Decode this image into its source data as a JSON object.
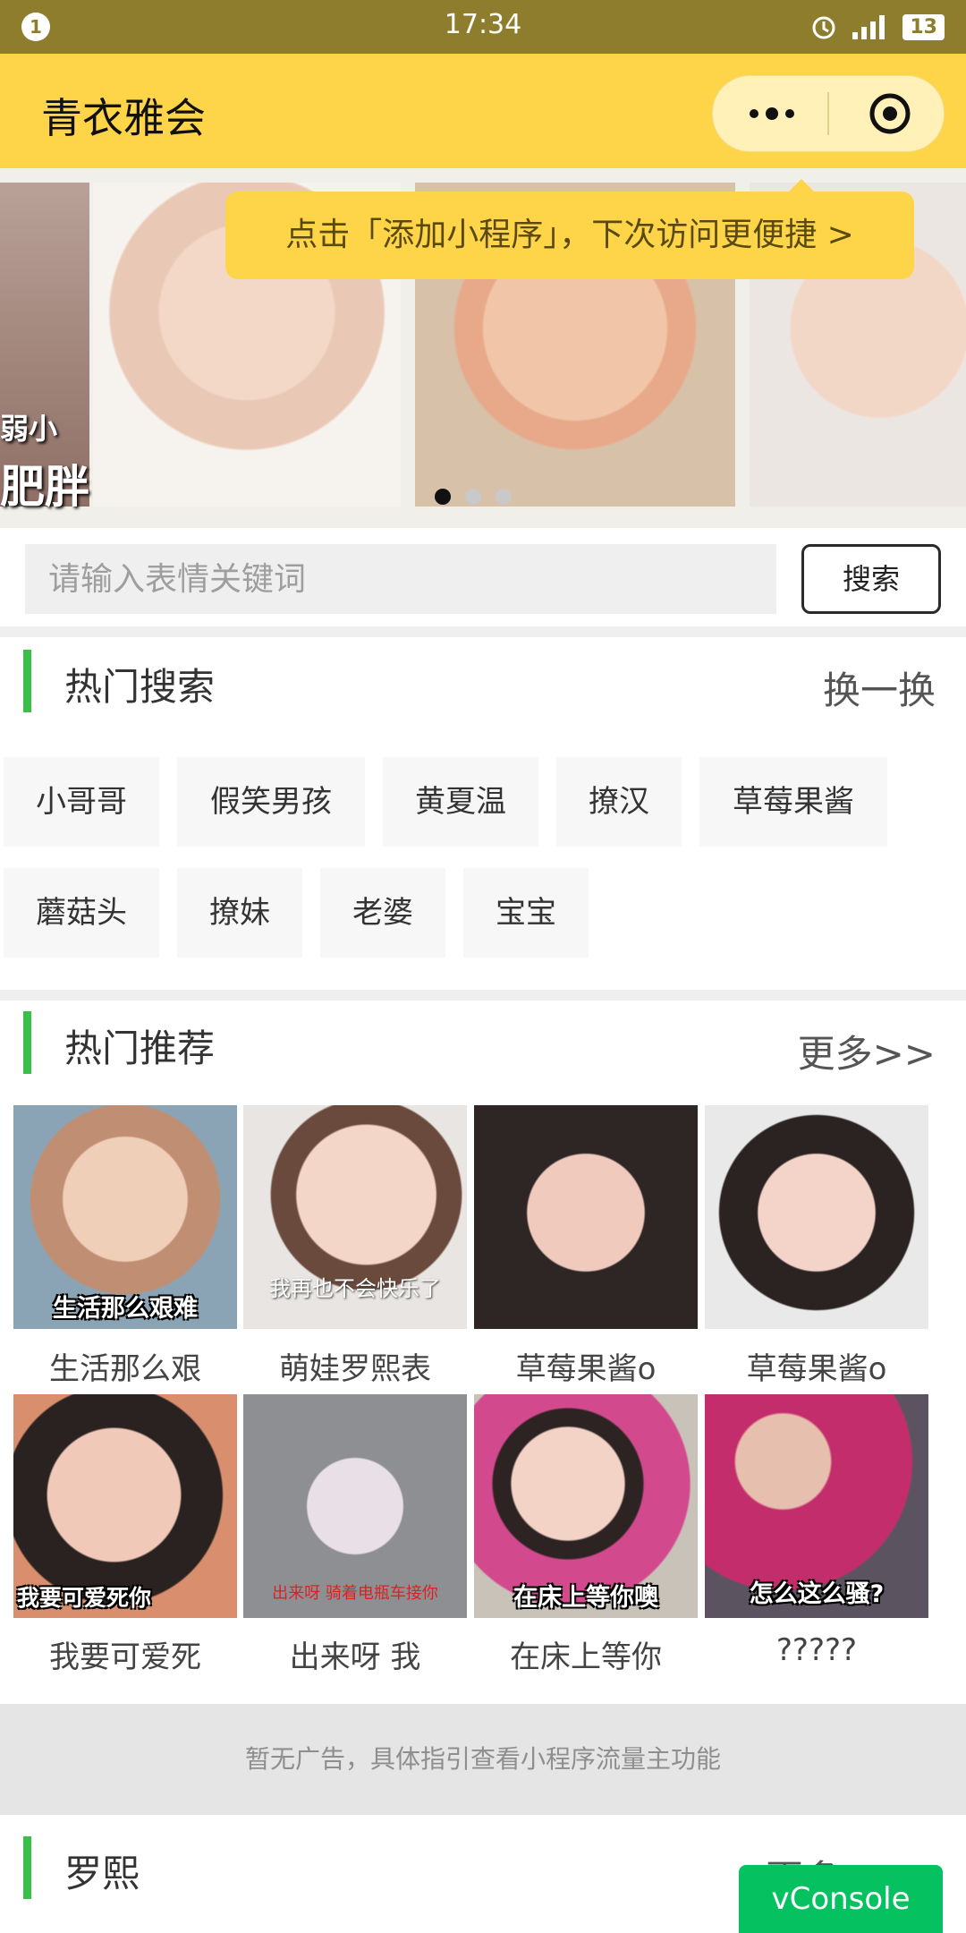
{
  "status": {
    "time": "17:34",
    "notification": "1",
    "network": "4G",
    "battery": "13"
  },
  "header": {
    "title": "青衣雅会"
  },
  "banner": {
    "slide_text_1": "弱小",
    "slide_text_2": "肥胖",
    "tooltip": "点击「添加小程序」，下次访问更便捷 >",
    "dots_count": 3,
    "active_dot": 0
  },
  "search": {
    "placeholder": "请输入表情关键词",
    "button": "搜索"
  },
  "hot_search": {
    "title": "热门搜索",
    "action": "换一换",
    "tags": [
      "小哥哥",
      "假笑男孩",
      "黄夏温",
      "撩汉",
      "草莓果酱",
      "蘑菇头",
      "撩妹",
      "老婆",
      "宝宝"
    ]
  },
  "recommend": {
    "title": "热门推荐",
    "action": "更多>>",
    "items": [
      {
        "label": "生活那么艰",
        "overlay": "生活那么艰难",
        "color": "#c7a58f"
      },
      {
        "label": "萌娃罗熙表",
        "overlay": "我再也不会快乐了",
        "color": "#d9c3b9"
      },
      {
        "label": "草莓果酱o",
        "overlay": "",
        "color": "#b99689"
      },
      {
        "label": "草莓果酱o",
        "overlay": "",
        "color": "#c8a49a"
      },
      {
        "label": "我要可爱死",
        "overlay": "我要可爱死你",
        "color": "#cfa596"
      },
      {
        "label": "出来呀 我",
        "overlay": "出来呀 骑着电瓶车接你",
        "color": "#9fa0a3"
      },
      {
        "label": "在床上等你",
        "overlay": "在床上等你噢",
        "color": "#bfa7a0"
      },
      {
        "label": "?????",
        "overlay": "怎么这么骚?",
        "color": "#a5606f"
      }
    ]
  },
  "ad": {
    "text": "暂无广告，具体指引查看小程序流量主功能"
  },
  "section3": {
    "title": "罗熙",
    "action": "更多"
  },
  "vconsole": {
    "label": "vConsole"
  }
}
